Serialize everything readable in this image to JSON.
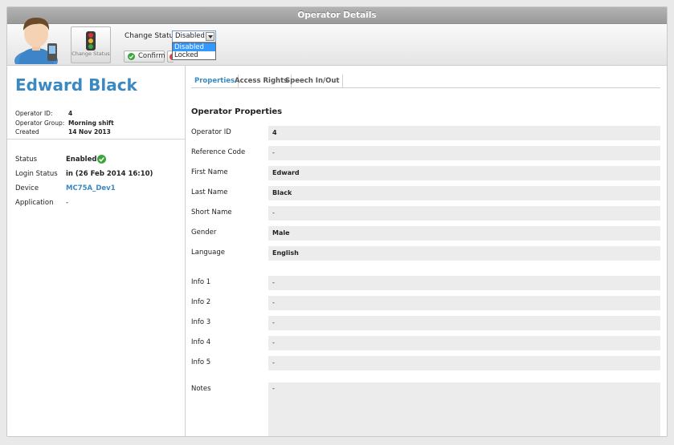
{
  "window": {
    "title": "Operator Details"
  },
  "toolbar": {
    "status_button_label": "Change Status",
    "change_status_label": "Change Status",
    "select_value": "Disabled",
    "options": [
      "Disabled",
      "Locked"
    ],
    "confirm_label": "Confirm"
  },
  "operator": {
    "name": "Edward Black",
    "meta": [
      {
        "key": "Operator ID:",
        "value": "4"
      },
      {
        "key": "Operator Group:",
        "value": "Morning shift"
      },
      {
        "key": "Created",
        "value": "14 Nov 2013"
      }
    ],
    "status": {
      "key": "Status",
      "value": "Enabled"
    },
    "login_status": {
      "key": "Login Status",
      "value": "in (26 Feb 2014 16:10)"
    },
    "device": {
      "key": "Device",
      "value": "MC75A_Dev1"
    },
    "application": {
      "key": "Application",
      "value": "-"
    }
  },
  "tabs": [
    "Properties",
    "Access Rights",
    "Speech In/Out"
  ],
  "properties": {
    "title": "Operator Properties",
    "rows": [
      {
        "label": "Operator ID",
        "value": "4"
      },
      {
        "label": "Reference Code",
        "value": "-"
      },
      {
        "label": "First Name",
        "value": "Edward"
      },
      {
        "label": "Last Name",
        "value": "Black"
      },
      {
        "label": "Short Name",
        "value": "-"
      },
      {
        "label": "Gender",
        "value": "Male"
      },
      {
        "label": "Language",
        "value": "English"
      },
      {
        "label": "Info 1",
        "value": "-"
      },
      {
        "label": "Info 2",
        "value": "-"
      },
      {
        "label": "Info 3",
        "value": "-"
      },
      {
        "label": "Info 4",
        "value": "-"
      },
      {
        "label": "Info 5",
        "value": "-"
      },
      {
        "label": "Notes",
        "value": "-"
      }
    ]
  },
  "colors": {
    "accent": "#3a89c1",
    "titlebar": "#a6a6a6",
    "field_bg": "#ececec",
    "ok_green": "#3aa53a"
  }
}
